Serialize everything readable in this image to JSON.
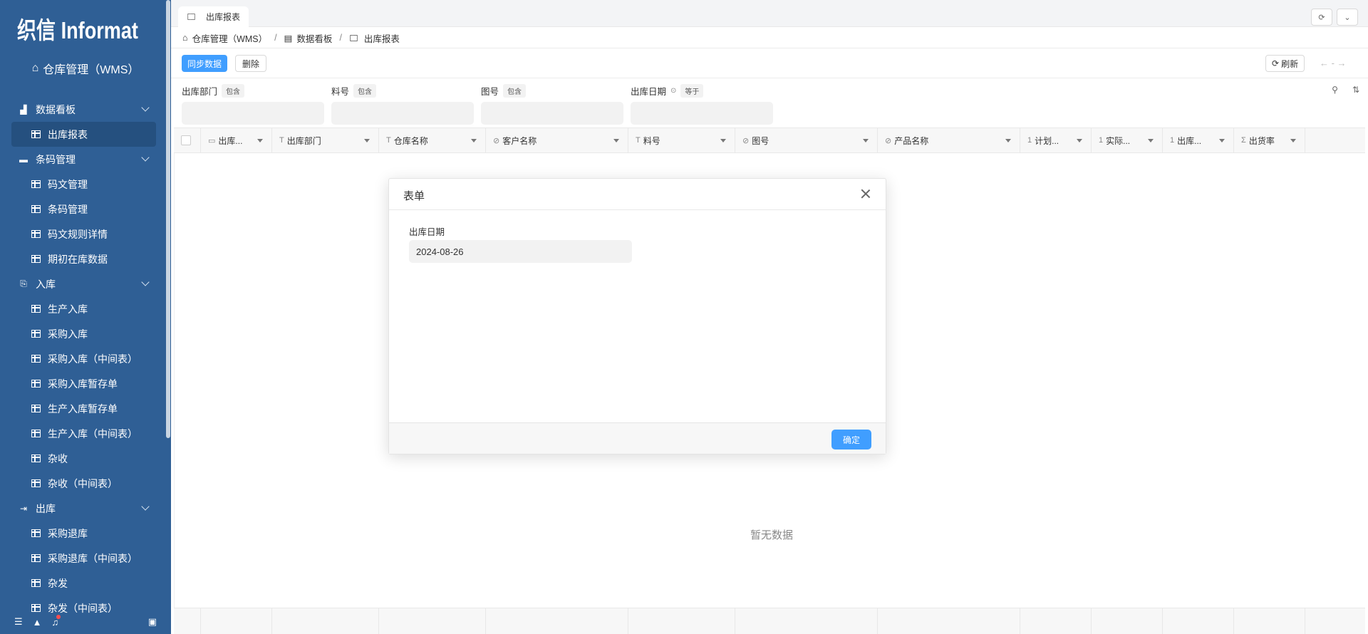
{
  "sidebar": {
    "logo_text": "织信 Informat",
    "app_name": "仓库管理（WMS）",
    "groups": [
      {
        "label": "数据看板",
        "items": [
          {
            "label": "出库报表",
            "active": true
          }
        ]
      },
      {
        "label": "条码管理",
        "items": [
          {
            "label": "码文管理"
          },
          {
            "label": "条码管理"
          },
          {
            "label": "码文规则详情"
          },
          {
            "label": "期初在库数据"
          }
        ]
      },
      {
        "label": "入库",
        "items": [
          {
            "label": "生产入库"
          },
          {
            "label": "采购入库"
          },
          {
            "label": "采购入库（中间表）"
          },
          {
            "label": "采购入库暂存单"
          },
          {
            "label": "生产入库暂存单"
          },
          {
            "label": "生产入库（中间表）"
          },
          {
            "label": "杂收"
          },
          {
            "label": "杂收（中间表）"
          }
        ]
      },
      {
        "label": "出库",
        "items": [
          {
            "label": "采购退库"
          },
          {
            "label": "采购退库（中间表）"
          },
          {
            "label": "杂发"
          },
          {
            "label": "杂发（中间表）"
          }
        ]
      }
    ]
  },
  "tabs": [
    {
      "label": "出库报表"
    }
  ],
  "breadcrumb": [
    {
      "label": "仓库管理（WMS）"
    },
    {
      "label": "数据看板"
    },
    {
      "label": "出库报表"
    }
  ],
  "toolbar": {
    "sync_label": "同步数据",
    "delete_label": "删除",
    "refresh_label": "刷新",
    "pager": "←  -  →"
  },
  "filters": [
    {
      "label": "出库部门",
      "op": "包含"
    },
    {
      "label": "料号",
      "op": "包含"
    },
    {
      "label": "图号",
      "op": "包含"
    },
    {
      "label": "出库日期",
      "op": "等于"
    }
  ],
  "table": {
    "columns": [
      {
        "icon": "calendar-icon",
        "glyph": "▭",
        "label": "出库..."
      },
      {
        "icon": "text-icon",
        "glyph": "T",
        "label": "出库部门"
      },
      {
        "icon": "text-icon",
        "glyph": "T",
        "label": "仓库名称"
      },
      {
        "icon": "link-icon",
        "glyph": "⊘",
        "label": "客户名称"
      },
      {
        "icon": "text-icon",
        "glyph": "T",
        "label": "料号"
      },
      {
        "icon": "link-icon",
        "glyph": "⊘",
        "label": "图号"
      },
      {
        "icon": "link-icon",
        "glyph": "⊘",
        "label": "产品名称"
      },
      {
        "icon": "number-icon",
        "glyph": "1",
        "label": "计划..."
      },
      {
        "icon": "number-icon",
        "glyph": "1",
        "label": "实际..."
      },
      {
        "icon": "number-icon",
        "glyph": "1",
        "label": "出库..."
      },
      {
        "icon": "sum-icon",
        "glyph": "Σ",
        "label": "出货率"
      }
    ],
    "empty_text": "暂无数据"
  },
  "modal": {
    "title": "表单",
    "field_label": "出库日期",
    "field_value": "2024-08-26",
    "ok_label": "确定"
  },
  "colors": {
    "sidebar_bg": "#2f5f95",
    "primary": "#409eff"
  }
}
